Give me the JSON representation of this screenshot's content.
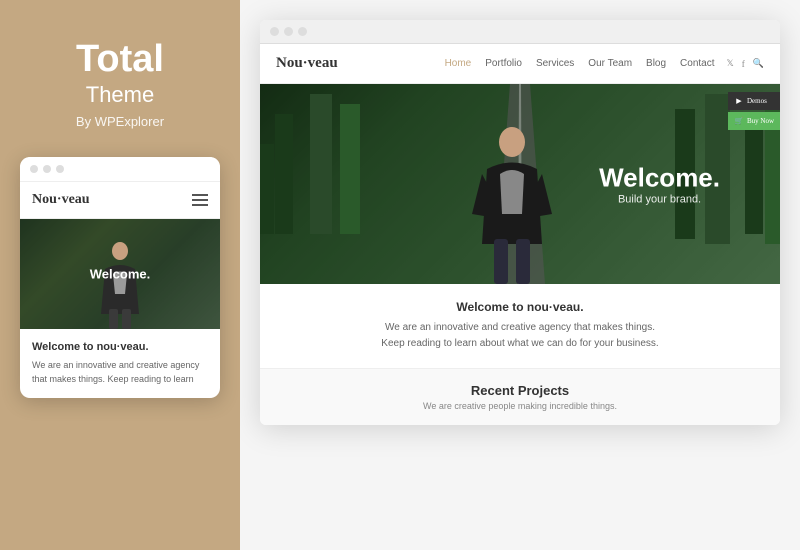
{
  "leftPanel": {
    "title": "Total",
    "subtitle": "Theme",
    "by": "By WPExplorer"
  },
  "mobileMockup": {
    "dots": [
      "dot1",
      "dot2",
      "dot3"
    ],
    "brand": "Nou·veau",
    "heroText": "Welcome.",
    "welcomeTitle": "Welcome to nou·veau.",
    "welcomeText": "We are an innovative and creative agency that makes things. Keep reading to learn"
  },
  "desktopMockup": {
    "dots": [
      "dot1",
      "dot2",
      "dot3"
    ],
    "brand": "Nou·veau",
    "navLinks": [
      {
        "label": "Home",
        "active": true
      },
      {
        "label": "Portfolio",
        "active": false
      },
      {
        "label": "Services",
        "active": false
      },
      {
        "label": "Our Team",
        "active": false
      },
      {
        "label": "Blog",
        "active": false
      },
      {
        "label": "Contact",
        "active": false
      }
    ],
    "navIcons": [
      "twitter-icon",
      "facebook-icon",
      "search-icon"
    ],
    "hero": {
      "welcomeText": "Welcome.",
      "subText": "Build your brand."
    },
    "sideButtons": [
      {
        "label": "Demos",
        "type": "dark"
      },
      {
        "label": "Buy Now",
        "type": "green"
      }
    ],
    "content": {
      "title": "Welcome to nou·veau.",
      "line1": "We are an innovative and creative agency that makes things.",
      "line2": "Keep reading to learn about what we can do for your business."
    },
    "projects": {
      "title": "Recent Projects",
      "subtitle": "We are creative people making incredible things."
    }
  }
}
